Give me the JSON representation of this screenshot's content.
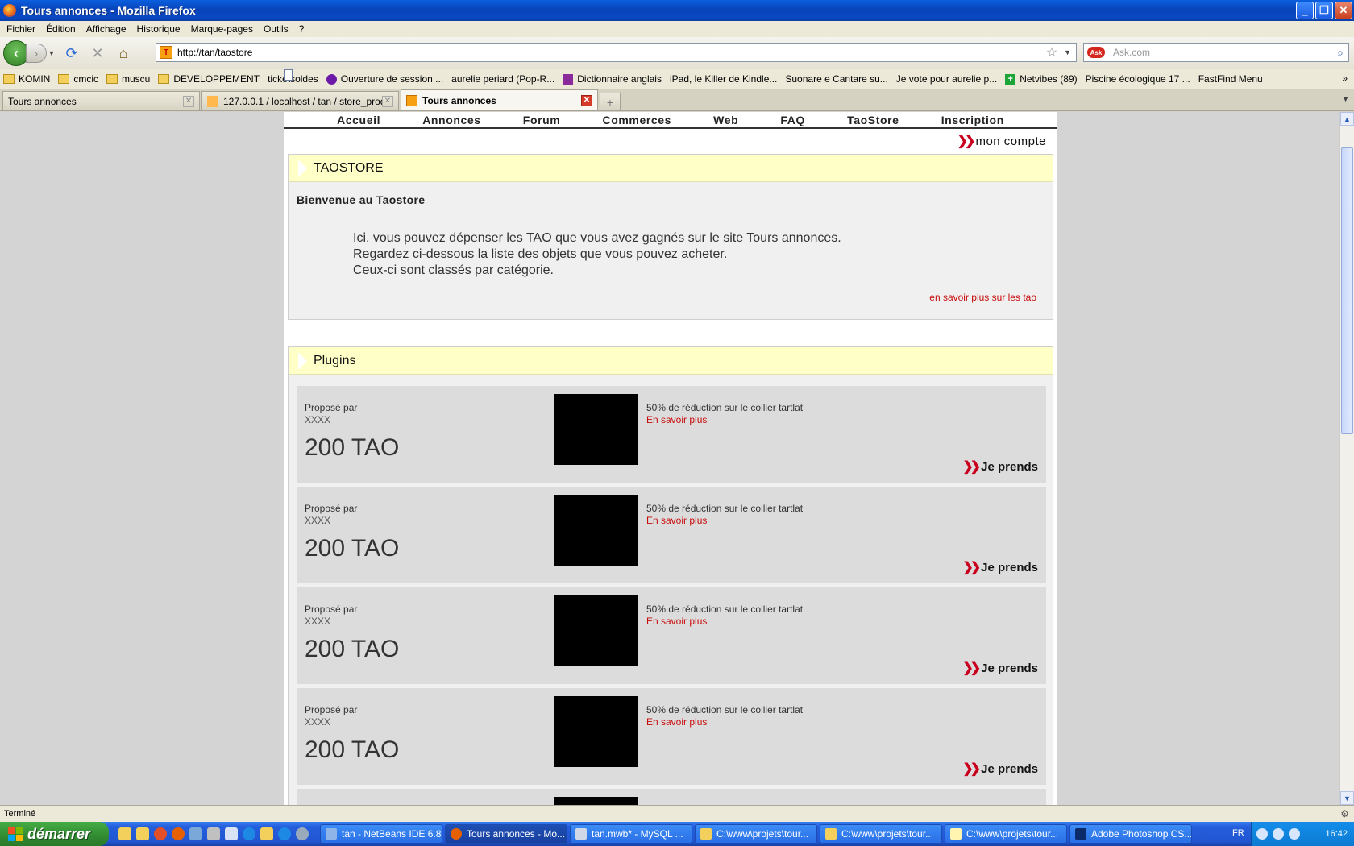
{
  "window": {
    "title": "Tours annonces - Mozilla Firefox"
  },
  "menu": [
    {
      "label": "Fichier"
    },
    {
      "label": "Édition"
    },
    {
      "label": "Affichage"
    },
    {
      "label": "Historique"
    },
    {
      "label": "Marque-pages"
    },
    {
      "label": "Outils"
    },
    {
      "label": "?"
    }
  ],
  "nav": {
    "url": "http://tan/taostore",
    "search_placeholder": "Ask.com"
  },
  "bookmarks": [
    {
      "label": "KOMIN",
      "icon": "folder"
    },
    {
      "label": "cmcic",
      "icon": "folder"
    },
    {
      "label": "muscu",
      "icon": "folder"
    },
    {
      "label": "DEVELOPPEMENT",
      "icon": "folder"
    },
    {
      "label": "ticketsoldes",
      "icon": "page"
    },
    {
      "label": "Ouverture de session ...",
      "icon": "yahoo"
    },
    {
      "label": "aurelie periard (Pop-R...",
      "icon": "page"
    },
    {
      "label": "Dictionnaire anglais",
      "icon": "wr"
    },
    {
      "label": "iPad, le Killer de Kindle...",
      "icon": "page"
    },
    {
      "label": "Suonare e Cantare su...",
      "icon": "page"
    },
    {
      "label": "Je vote pour aurelie p...",
      "icon": "page"
    },
    {
      "label": "Netvibes (89)",
      "icon": "plus"
    },
    {
      "label": "Piscine écologique 17 ...",
      "icon": "page"
    },
    {
      "label": "FastFind Menu",
      "icon": "page"
    }
  ],
  "tabs": [
    {
      "label": "Tours annonces",
      "active": false
    },
    {
      "label": "127.0.0.1 / localhost / tan / store_prod...",
      "active": false
    },
    {
      "label": "Tours annonces",
      "active": true
    }
  ],
  "site": {
    "nav": [
      "Accueil",
      "Annonces",
      "Forum",
      "Commerces",
      "Web",
      "FAQ",
      "TaoStore",
      "Inscription"
    ],
    "account": "mon compte",
    "taostore": {
      "title": "TAOSTORE",
      "welcome": "Bienvenue au Taostore",
      "lines": [
        "Ici, vous pouvez dépenser les TAO que vous avez gagnés sur le site Tours annonces.",
        "Regardez ci-dessous la liste des objets que vous pouvez acheter.",
        "Ceux-ci sont classés par catégorie."
      ],
      "more_link": "en savoir plus sur les tao"
    },
    "plugins": {
      "title": "Plugins",
      "items": [
        {
          "by_label": "Proposé par",
          "by": "XXXX",
          "price": "200 TAO",
          "desc": "50% de réduction sur le collier tartlat",
          "link": "En savoir plus",
          "action": "Je prends"
        },
        {
          "by_label": "Proposé par",
          "by": "XXXX",
          "price": "200 TAO",
          "desc": "50% de réduction sur le collier tartlat",
          "link": "En savoir plus",
          "action": "Je prends"
        },
        {
          "by_label": "Proposé par",
          "by": "XXXX",
          "price": "200 TAO",
          "desc": "50% de réduction sur le collier tartlat",
          "link": "En savoir plus",
          "action": "Je prends"
        },
        {
          "by_label": "Proposé par",
          "by": "XXXX",
          "price": "200 TAO",
          "desc": "50% de réduction sur le collier tartlat",
          "link": "En savoir plus",
          "action": "Je prends"
        }
      ]
    }
  },
  "status": {
    "text": "Terminé"
  },
  "taskbar": {
    "start": "démarrer",
    "buttons": [
      {
        "label": "tan - NetBeans IDE 6.8",
        "active": false
      },
      {
        "label": "Tours annonces - Mo...",
        "active": true
      },
      {
        "label": "tan.mwb* - MySQL ...",
        "active": false
      },
      {
        "label": "C:\\www\\projets\\tour...",
        "active": false
      },
      {
        "label": "C:\\www\\projets\\tour...",
        "active": false
      },
      {
        "label": "C:\\www\\projets\\tour...",
        "active": false
      },
      {
        "label": "Adobe Photoshop CS...",
        "active": false
      }
    ],
    "lang": "FR",
    "clock": "16:42"
  },
  "colors": {
    "accent_red": "#c80c0c",
    "box_header": "#ffffc8",
    "xp_blue": "#245edc",
    "start_green": "#318a31"
  }
}
